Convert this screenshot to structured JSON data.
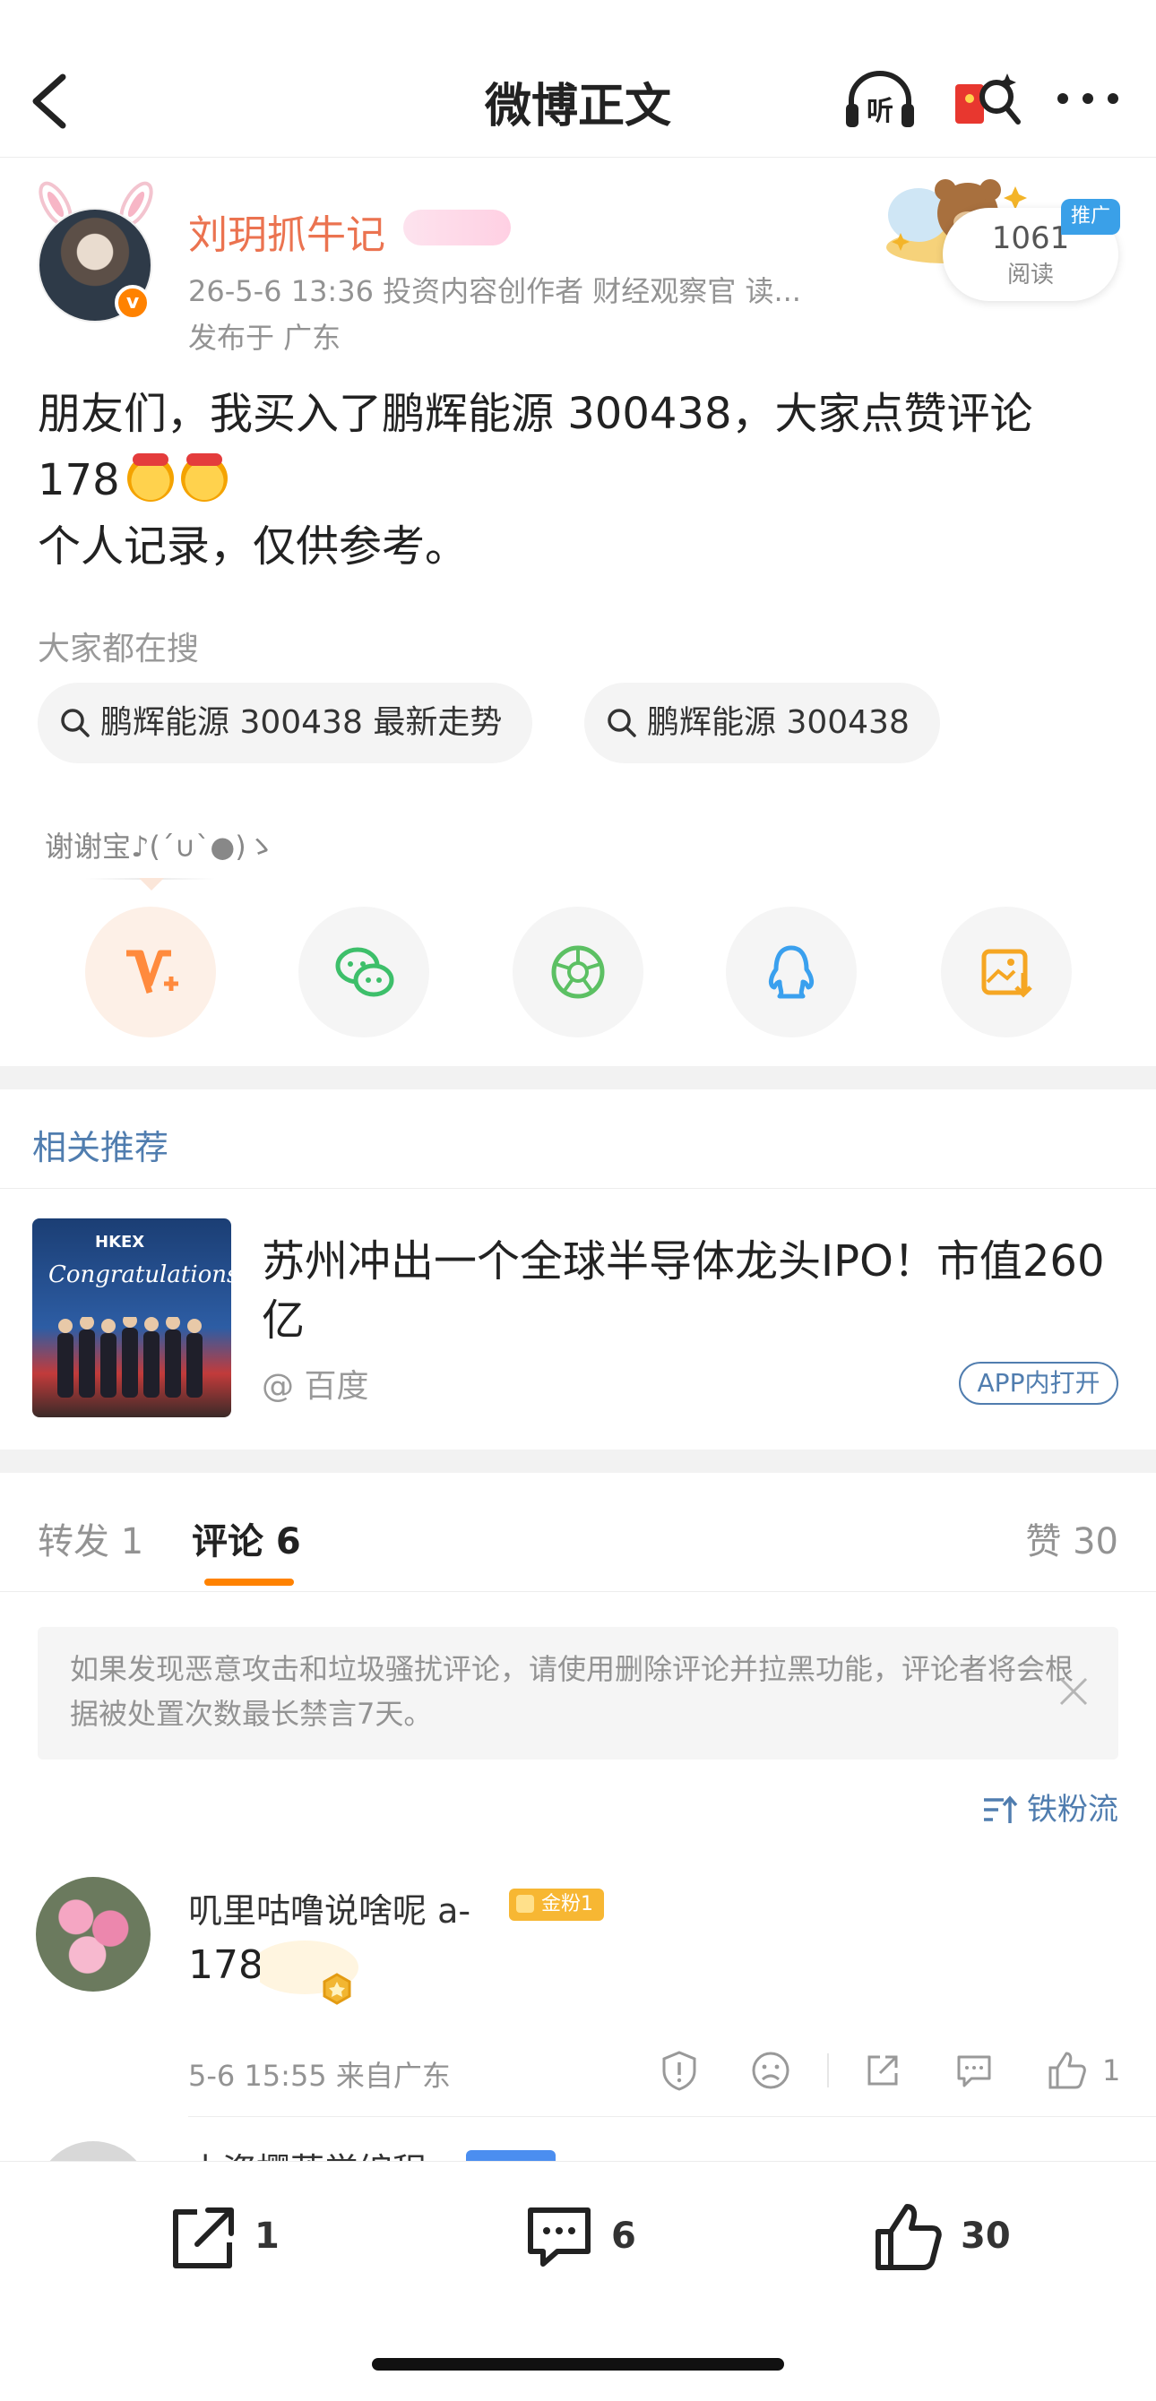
{
  "header": {
    "title": "微博正文",
    "listen_label": "听"
  },
  "author": {
    "name": "刘玥抓牛记",
    "meta": "26-5-6 13:36  投资内容创作者 财经观察官 读...",
    "location": "发布于 广东",
    "read_count": "1061",
    "read_label": "阅读",
    "ad_tag": "推广"
  },
  "post": {
    "line1": "朋友们，我买入了鹏辉能源 300438，大家点赞评论",
    "line2": "178",
    "line3": "个人记录，仅供参考。"
  },
  "search": {
    "title": "大家都在搜",
    "chips": [
      "鹏辉能源 300438 最新走势",
      "鹏辉能源 300438"
    ]
  },
  "share": {
    "thanks": "谢谢宝♪(´∪`●)ゝ"
  },
  "related": {
    "title": "相关推荐",
    "headline": "苏州冲出一个全球半导体龙头IPO！市值260亿",
    "source": "@ 百度",
    "open_label": "APP内打开",
    "image_text": "HKEX",
    "image_script": "Congratulations!"
  },
  "tabs": {
    "repost": "转发 1",
    "comments": "评论 6",
    "likes": "赞 30"
  },
  "notice": {
    "text": "如果发现恶意攻击和垃圾骚扰评论，请使用删除评论并拉黑功能，评论者将会根据被处置次数最长禁言7天。"
  },
  "sort": {
    "label": "铁粉流"
  },
  "comments": [
    {
      "name": "叽里咕噜说啥呢 a-",
      "badge": "金粉1",
      "text": "178",
      "time": "5-6 15:55  来自广东",
      "likes": "1"
    },
    {
      "name": "小资樱落学编程"
    }
  ],
  "bottom_bar": {
    "repost_count": "1",
    "comment_count": "6",
    "like_count": "30"
  },
  "colors": {
    "accent_orange": "#ff8200",
    "link_blue": "#507daf",
    "name_orange": "#eb7350"
  }
}
